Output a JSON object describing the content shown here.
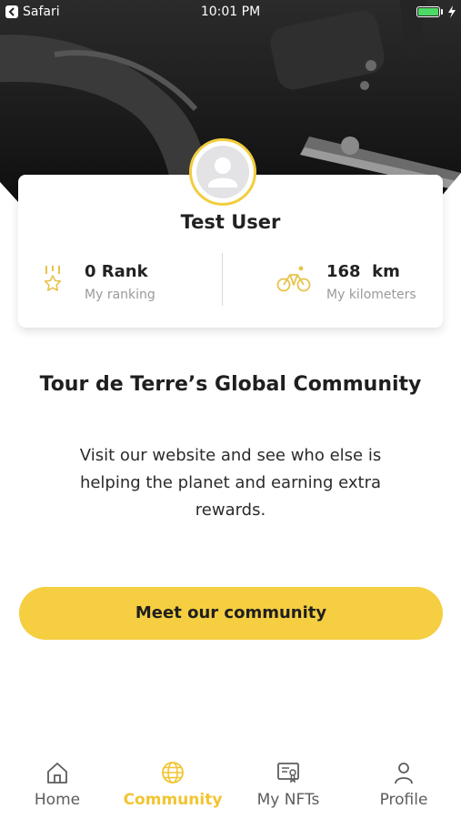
{
  "status_bar": {
    "app_name": "Safari",
    "time": "10:01 PM",
    "battery_color": "#4cd964"
  },
  "profile": {
    "user_name": "Test User",
    "avatar_icon": "user-placeholder-icon",
    "stats": [
      {
        "value": "0 Rank",
        "label": "My ranking",
        "icon": "ranking-star-icon"
      },
      {
        "value": "168  km",
        "label": "My kilometers",
        "icon": "bicycle-icon"
      }
    ]
  },
  "community": {
    "title": "Tour de Terre’s Global Community",
    "description": "Visit our website and see who else is helping the planet and earning extra rewards.",
    "cta_label": "Meet our community"
  },
  "tabs": [
    {
      "label": "Home",
      "icon": "home-icon",
      "active": false
    },
    {
      "label": "Community",
      "icon": "globe-icon",
      "active": true
    },
    {
      "label": "My NFTs",
      "icon": "nft-certificate-icon",
      "active": false
    },
    {
      "label": "Profile",
      "icon": "profile-icon",
      "active": false
    }
  ],
  "colors": {
    "accent": "#f5ce41",
    "active_tab": "#f2c431",
    "hero_background": "#1c1c1c"
  }
}
